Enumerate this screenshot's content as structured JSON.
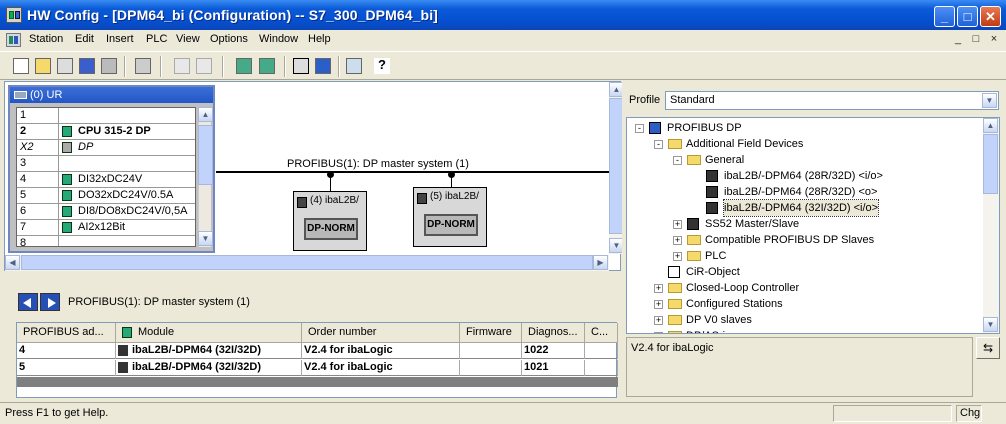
{
  "window": {
    "title": "HW Config - [DPM64_bi (Configuration) -- S7_300_DPM64_bi]"
  },
  "menu": [
    "Station",
    "Edit",
    "Insert",
    "PLC",
    "View",
    "Options",
    "Window",
    "Help"
  ],
  "mdi_controls": [
    "_",
    "□",
    "×"
  ],
  "rack": {
    "title": "(0) UR",
    "rows": [
      {
        "slot": "1",
        "module": "",
        "bold": false,
        "icon": false
      },
      {
        "slot": "2",
        "module": "CPU 315-2 DP",
        "bold": true,
        "icon": true
      },
      {
        "slot": "X2",
        "module": "DP",
        "bold": false,
        "icon": true,
        "italic": true
      },
      {
        "slot": "3",
        "module": "",
        "bold": false,
        "icon": false
      },
      {
        "slot": "4",
        "module": "DI32xDC24V",
        "bold": false,
        "icon": true
      },
      {
        "slot": "5",
        "module": "DO32xDC24V/0.5A",
        "bold": false,
        "icon": true
      },
      {
        "slot": "6",
        "module": "DI8/DO8xDC24V/0,5A",
        "bold": false,
        "icon": true
      },
      {
        "slot": "7",
        "module": "AI2x12Bit",
        "bold": false,
        "icon": true
      },
      {
        "slot": "8",
        "module": "",
        "bold": false,
        "icon": false
      }
    ]
  },
  "network": {
    "bus_label": "PROFIBUS(1): DP master system (1)",
    "slaves": [
      {
        "label": "(4) ibaL2B/",
        "name": "DP-NORM"
      },
      {
        "label": "(5) ibaL2B/",
        "name": "DP-NORM"
      }
    ]
  },
  "detail": {
    "title": "PROFIBUS(1): DP master system (1)",
    "columns": [
      "PROFIBUS ad...",
      "Module",
      "Order number",
      "Firmware",
      "Diagnos...",
      "C..."
    ],
    "rows": [
      {
        "address": "4",
        "module": "ibaL2B/-DPM64 (32I/32D)",
        "order": "V2.4 for ibaLogic",
        "firmware": "",
        "diag": "1022",
        "c": ""
      },
      {
        "address": "5",
        "module": "ibaL2B/-DPM64 (32I/32D)",
        "order": "V2.4 for ibaLogic",
        "firmware": "",
        "diag": "1021",
        "c": ""
      }
    ]
  },
  "catalog": {
    "profile_label": "Profile",
    "profile_value": "Standard",
    "tree": [
      {
        "label": "PROFIBUS DP",
        "level": 0,
        "expander": "-",
        "icon": "network"
      },
      {
        "label": "Additional Field Devices",
        "level": 1,
        "expander": "-",
        "icon": "folder"
      },
      {
        "label": "General",
        "level": 2,
        "expander": "-",
        "icon": "folder"
      },
      {
        "label": "ibaL2B/-DPM64 (28R/32D) <i/o>",
        "level": 3,
        "expander": "",
        "icon": "device"
      },
      {
        "label": "ibaL2B/-DPM64 (28R/32D) <o>",
        "level": 3,
        "expander": "",
        "icon": "device"
      },
      {
        "label": "ibaL2B/-DPM64 (32I/32D) <i/o>",
        "level": 3,
        "expander": "",
        "icon": "device",
        "selected": true
      },
      {
        "label": "SS52 Master/Slave",
        "level": 2,
        "expander": "+",
        "icon": "device"
      },
      {
        "label": "Compatible PROFIBUS DP Slaves",
        "level": 2,
        "expander": "+",
        "icon": "folder"
      },
      {
        "label": "PLC",
        "level": 2,
        "expander": "+",
        "icon": "folder"
      },
      {
        "label": "CiR-Object",
        "level": 1,
        "expander": "",
        "icon": "cir"
      },
      {
        "label": "Closed-Loop Controller",
        "level": 1,
        "expander": "+",
        "icon": "folder"
      },
      {
        "label": "Configured Stations",
        "level": 1,
        "expander": "+",
        "icon": "folder"
      },
      {
        "label": "DP V0 slaves",
        "level": 1,
        "expander": "+",
        "icon": "folder"
      },
      {
        "label": "DP/AS-i",
        "level": 1,
        "expander": "+",
        "icon": "folder"
      }
    ],
    "info": "V2.4 for ibaLogic"
  },
  "status": {
    "text": "Press F1 to get Help.",
    "panel": "Chg"
  }
}
